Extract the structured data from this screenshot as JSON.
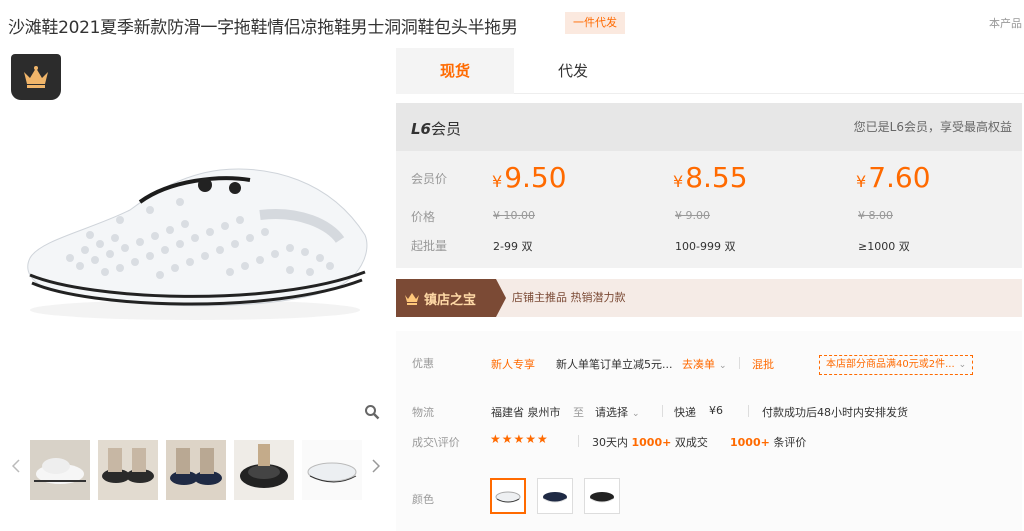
{
  "product": {
    "title": "沙滩鞋2021夏季新款防滑一字拖鞋情侣凉拖鞋男士洞洞鞋包头半拖男",
    "badge": "一件代发",
    "corner_text": "本产品"
  },
  "tabs": [
    {
      "label": "现货",
      "active": true
    },
    {
      "label": "代发",
      "active": false
    }
  ],
  "member": {
    "level_prefix": "L6",
    "level_suffix": "会员",
    "note": "您已是L6会员，享受最高权益",
    "row_labels": {
      "member_price": "会员价",
      "price": "价格",
      "moq": "起批量"
    },
    "currency": "¥",
    "tiers": [
      {
        "member_price": "9.50",
        "original": "¥ 10.00",
        "qty": "2-99 双"
      },
      {
        "member_price": "8.55",
        "original": "¥ 9.00",
        "qty": "100-999 双"
      },
      {
        "member_price": "7.60",
        "original": "¥ 8.00",
        "qty": "≥1000 双"
      }
    ]
  },
  "shop": {
    "badge_label": "镇店之宝",
    "tags": "店铺主推品  热销潜力款"
  },
  "promo": {
    "label": "优惠",
    "new_user": "新人专享",
    "new_user_desc": "新人单笔订单立减5元...",
    "collect": "去凑单",
    "mixed": "混批",
    "coupon": "本店部分商品满40元或2件..."
  },
  "logistics": {
    "label": "物流",
    "from": "福建省 泉州市",
    "to_label": "至",
    "to": "请选择",
    "courier": "快递",
    "fee": "¥6",
    "ship_note": "付款成功后48小时内安排发货"
  },
  "reviews": {
    "label": "成交\\评价",
    "stars": "★★★★★",
    "sold_prefix": "30天内",
    "sold_count": "1000+",
    "sold_suffix": "双成交",
    "review_count": "1000+",
    "review_suffix": "条评价"
  },
  "color": {
    "label": "颜色",
    "swatches": [
      "white",
      "navy",
      "black"
    ]
  },
  "thumbnails": [
    "white-shoe",
    "black-shoe-pair",
    "navy-shoe-pair",
    "black-fur-slipper",
    "white-shoe-side"
  ],
  "colors": {
    "accent": "#ff6a00",
    "banner_brown": "#7b4a35",
    "panel_gray": "#e7e7e7"
  }
}
